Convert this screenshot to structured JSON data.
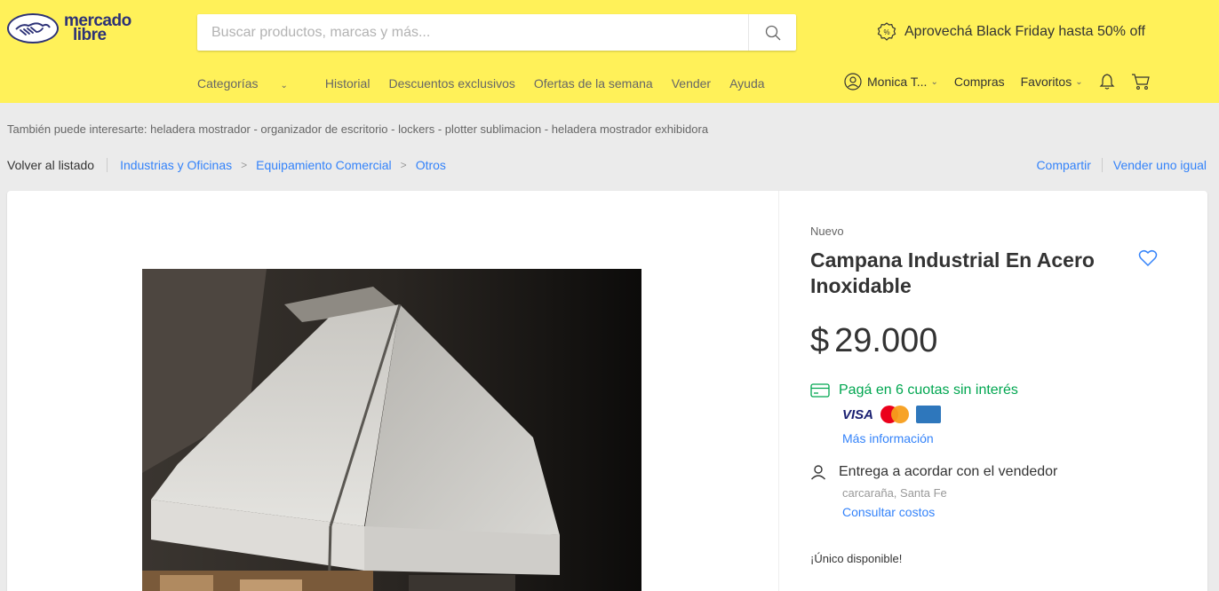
{
  "header": {
    "logo_line1": "mercado",
    "logo_line2": "libre",
    "search_placeholder": "Buscar productos, marcas y más...",
    "promo_text": "Aprovechá Black Friday hasta 50% off",
    "nav": [
      "Categorías",
      "Historial",
      "Descuentos exclusivos",
      "Ofertas de la semana",
      "Vender",
      "Ayuda"
    ],
    "user_name": "Monica T...",
    "purchases": "Compras",
    "favorites": "Favoritos"
  },
  "suggestions": "También puede interesarte: heladera mostrador - organizador de escritorio - lockers - plotter sublimacion - heladera mostrador exhibidora",
  "breadcrumb": {
    "back": "Volver al listado",
    "items": [
      "Industrias y Oficinas",
      "Equipamiento Comercial",
      "Otros"
    ]
  },
  "actions": {
    "share": "Compartir",
    "sell_similar": "Vender uno igual"
  },
  "product": {
    "condition": "Nuevo",
    "title": "Campana Industrial En Acero Inoxidable",
    "currency": "$",
    "price": "29.000",
    "installments": "Pagá en 6 cuotas sin interés",
    "card_visa": "VISA",
    "more_info": "Más información",
    "delivery": "Entrega a acordar con el vendedor",
    "location": "carcaraña, Santa Fe",
    "costs": "Consultar costos",
    "stock": "¡Único disponible!"
  },
  "colors": {
    "header_bg": "#fff159",
    "link": "#3483fa",
    "success": "#00a650",
    "brand": "#2d3277"
  }
}
